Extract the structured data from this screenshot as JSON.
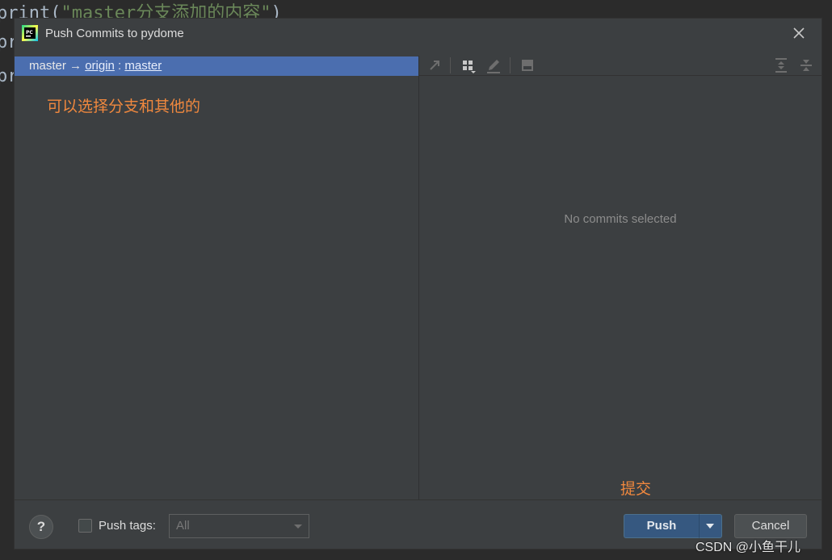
{
  "background_code": {
    "line1_prefix": "print(",
    "line1_string": "\"master分支添加的内容\"",
    "line1_suffix": ")",
    "line2_fragment": "pr",
    "line3_fragment": "pr"
  },
  "dialog": {
    "title": "Push Commits to pydome",
    "app_icon": "pycharm-icon",
    "close_icon": "close-icon"
  },
  "branch_row": {
    "local": "master",
    "arrow": "→",
    "remote": "origin",
    "separator": ":",
    "remote_branch": "master"
  },
  "annotations": {
    "left_note": "可以选择分支和其他的",
    "push_note": "提交"
  },
  "right_pane": {
    "empty_text": "No commits selected",
    "toolbar_icons": [
      "cherry-pick-icon",
      "group-by-icon",
      "edit-icon",
      "diff-icon",
      "expand-all-icon",
      "collapse-all-icon"
    ]
  },
  "footer": {
    "help_label": "?",
    "push_tags_label": "Push tags:",
    "push_tags_checked": false,
    "tags_select_value": "All",
    "push_label": "Push",
    "cancel_label": "Cancel"
  },
  "watermark": "CSDN @小鱼干儿",
  "colors": {
    "selection": "#4b6eaf",
    "annotation": "#f0883e",
    "primary_button": "#365880",
    "dialog_bg": "#3c3f41"
  }
}
